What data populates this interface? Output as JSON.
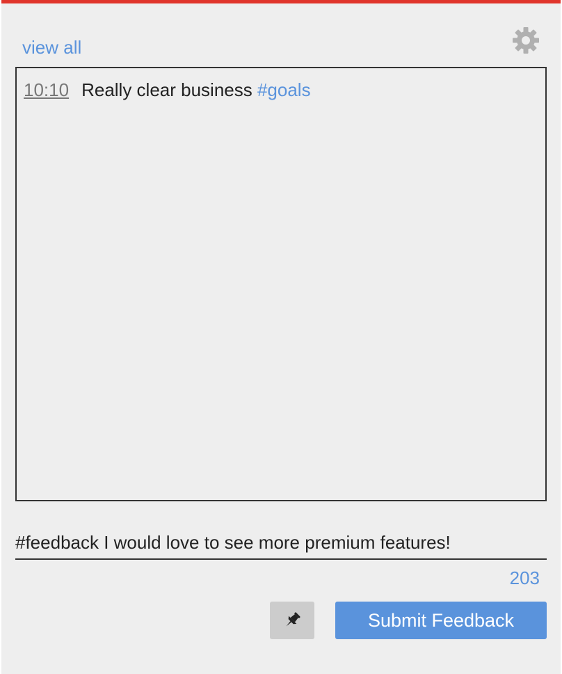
{
  "header": {
    "view_all_label": "view all",
    "settings_icon": "gear-icon"
  },
  "feed": {
    "entries": [
      {
        "timestamp": "10:10",
        "text": "Really clear business ",
        "hashtag": "#goals"
      }
    ]
  },
  "composer": {
    "value": "#feedback I would love to see more premium features!",
    "char_count": "203"
  },
  "actions": {
    "pin_icon": "pin-icon",
    "submit_label": "Submit Feedback"
  },
  "colors": {
    "accent": "#5a93dc",
    "top_bar": "#e0352b",
    "background": "#eeeeee",
    "pin_button": "#cccccc"
  }
}
